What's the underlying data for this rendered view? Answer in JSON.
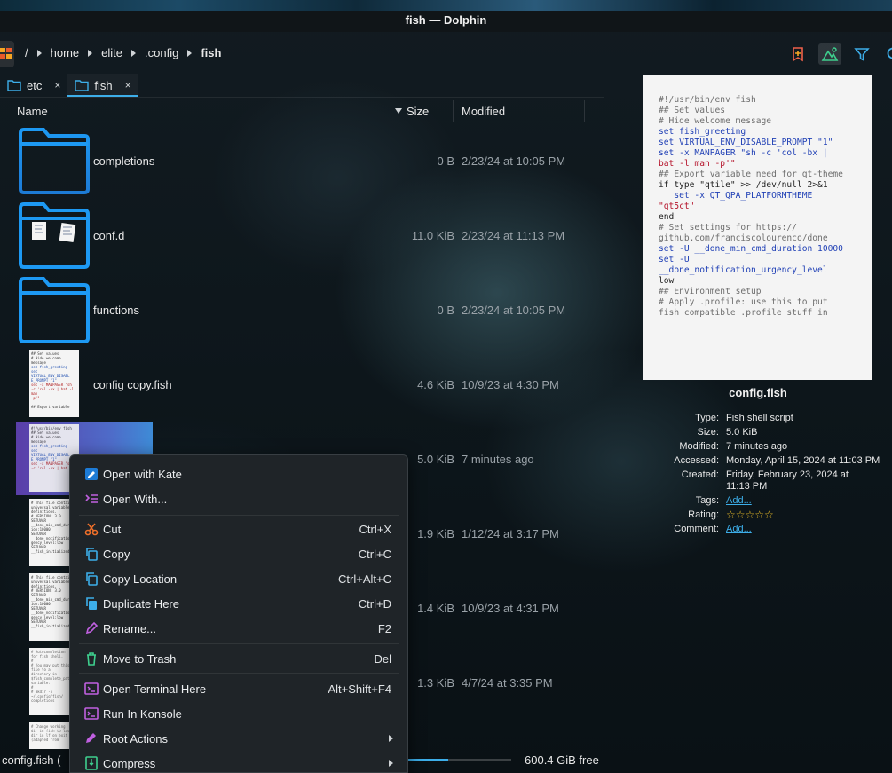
{
  "window": {
    "title": "fish — Dolphin"
  },
  "breadcrumb": [
    {
      "label": "/"
    },
    {
      "label": "home"
    },
    {
      "label": "elite"
    },
    {
      "label": ".config"
    },
    {
      "label": "fish"
    }
  ],
  "tabs": [
    {
      "label": "etc",
      "close": "×"
    },
    {
      "label": "fish",
      "close": "×"
    }
  ],
  "columns": {
    "name": "Name",
    "size": "Size",
    "modified": "Modified"
  },
  "files": [
    {
      "name": "completions",
      "size": "0 B",
      "modified": "2/23/24 at 10:05 PM"
    },
    {
      "name": "conf.d",
      "size": "11.0 KiB",
      "modified": "2/23/24 at 11:13 PM"
    },
    {
      "name": "functions",
      "size": "0 B",
      "modified": "2/23/24 at 10:05 PM"
    },
    {
      "name": "config copy.fish",
      "size": "4.6 KiB",
      "modified": "10/9/23 at 4:30 PM"
    },
    {
      "name": "",
      "size": "5.0 KiB",
      "modified": "7 minutes ago"
    },
    {
      "name": "",
      "size": "1.9 KiB",
      "modified": "1/12/24 at 3:17 PM"
    },
    {
      "name": "",
      "size": "1.4 KiB",
      "modified": "10/9/23 at 4:31 PM"
    },
    {
      "name": "",
      "size": "1.3 KiB",
      "modified": "4/7/24 at 3:35 PM"
    }
  ],
  "status": {
    "text": "config.fish (",
    "free": "600.4 GiB free",
    "used_fraction": 0.4
  },
  "context_menu": [
    {
      "label": "Open with Kate",
      "shortcut": ""
    },
    {
      "label": "Open With...",
      "shortcut": ""
    },
    {
      "label": "Cut",
      "shortcut": "Ctrl+X"
    },
    {
      "label": "Copy",
      "shortcut": "Ctrl+C"
    },
    {
      "label": "Copy Location",
      "shortcut": "Ctrl+Alt+C"
    },
    {
      "label": "Duplicate Here",
      "shortcut": "Ctrl+D"
    },
    {
      "label": "Rename...",
      "shortcut": "F2"
    },
    {
      "label": "Move to Trash",
      "shortcut": "Del"
    },
    {
      "label": "Open Terminal Here",
      "shortcut": "Alt+Shift+F4"
    },
    {
      "label": "Run In Konsole",
      "shortcut": ""
    },
    {
      "label": "Root Actions",
      "shortcut": ""
    },
    {
      "label": "Compress",
      "shortcut": ""
    }
  ],
  "preview": {
    "lines": [
      "#!/usr/bin/env fish",
      "## Set values",
      "# Hide welcome message",
      "set fish_greeting",
      "set VIRTUAL_ENV_DISABLE_PROMPT \"1\"",
      "set -x MANPAGER \"sh -c 'col -bx |",
      "bat -l man -p'\"",
      "",
      "## Export variable need for qt-theme",
      "if type \"qtile\" >> /dev/null 2>&1",
      "   set -x QT_QPA_PLATFORMTHEME",
      "\"qt5ct\"",
      "end",
      "",
      "# Set settings for https://",
      "github.com/franciscolourenco/done",
      "set -U __done_min_cmd_duration 10000",
      "set -U",
      "__done_notification_urgency_level",
      "low",
      "",
      "",
      "## Environment setup",
      "# Apply .profile: use this to put",
      "fish compatible .profile stuff in"
    ]
  },
  "info": {
    "title": "config.fish",
    "rows": [
      {
        "key": "Type:",
        "value": "Fish shell script"
      },
      {
        "key": "Size:",
        "value": "5.0 KiB"
      },
      {
        "key": "Modified:",
        "value": "7 minutes ago"
      },
      {
        "key": "Accessed:",
        "value": "Monday, April 15, 2024 at 11:03 PM"
      },
      {
        "key": "Created:",
        "value": "Friday, February 23, 2024 at 11:13 PM"
      },
      {
        "key": "Tags:",
        "value": "Add..."
      },
      {
        "key": "Rating:",
        "value": "☆☆☆☆☆"
      },
      {
        "key": "Comment:",
        "value": "Add..."
      }
    ]
  },
  "colors": {
    "accent": "#3daee9",
    "menu_bg": "#1f2428",
    "selection": "#5a3ea8"
  }
}
